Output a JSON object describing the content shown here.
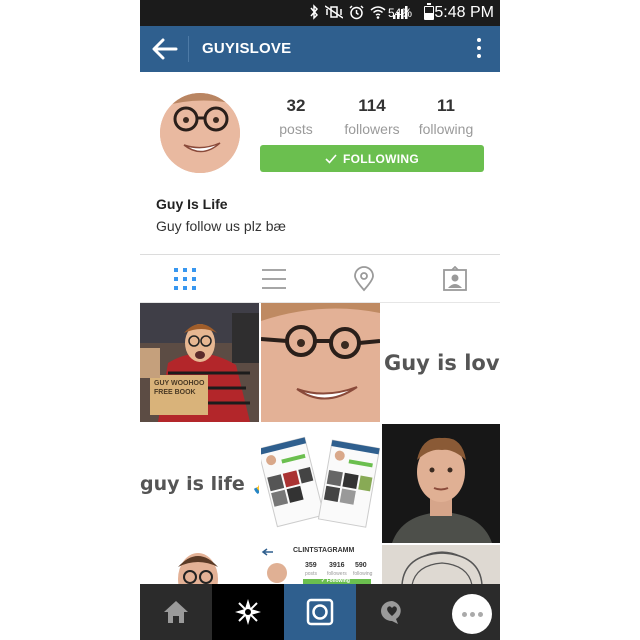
{
  "status_bar": {
    "battery": "54%",
    "battery_level": 0.54,
    "time": "5:48 PM",
    "icons": [
      "bluetooth-icon",
      "mute-vibrate-icon",
      "alarm-icon",
      "wifi-icon",
      "signal-icon",
      "battery-icon"
    ]
  },
  "header": {
    "title": "GUYISLOVE",
    "back_icon": "back-arrow-icon",
    "menu_icon": "more-vert-icon"
  },
  "profile": {
    "stats": [
      {
        "value": "32",
        "label": "posts"
      },
      {
        "value": "114",
        "label": "followers"
      },
      {
        "value": "11",
        "label": "following"
      }
    ],
    "follow_button": "FOLLOWING",
    "name": "Guy Is Life",
    "bio": "Guy follow us plz bæ"
  },
  "view_tabs": [
    "grid-view-icon",
    "list-view-icon",
    "location-icon",
    "tagged-photos-icon"
  ],
  "grid": {
    "captions": {
      "tile1_sign": "GUY WOOHOO FREE BOOK",
      "tile3": "Guy is love,",
      "tile4": "guy is life 🙏",
      "tile8_header": "CLINTSTAGRAMM",
      "tile8_stats": [
        {
          "value": "359",
          "label": "posts"
        },
        {
          "value": "3916",
          "label": "followers"
        },
        {
          "value": "590",
          "label": "following"
        }
      ],
      "tile8_button": "✓ Following"
    }
  },
  "bottom_nav": [
    "home-icon",
    "explore-icon",
    "camera-icon",
    "activity-icon",
    "chat-bubble-icon"
  ],
  "colors": {
    "header": "#2f5f8e",
    "following": "#6bbf4f",
    "active_nav": "#2f5f8e",
    "nav_bg": "#2b2b2b",
    "tab_active": "#3897f0"
  }
}
